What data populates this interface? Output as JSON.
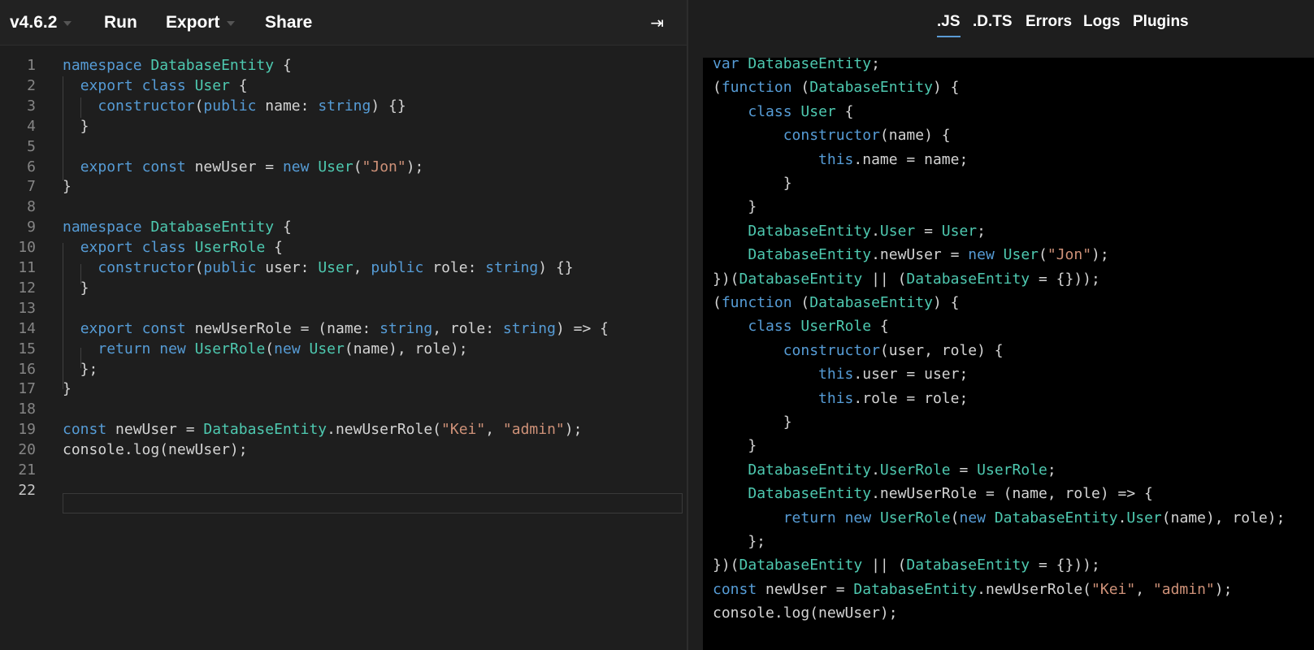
{
  "toolbar": {
    "version": "v4.6.2",
    "run": "Run",
    "export": "Export",
    "share": "Share",
    "collapse_glyph": "⇥"
  },
  "output_tabs": [
    {
      "label": ".JS",
      "active": true
    },
    {
      "label": ".D.TS",
      "active": false
    },
    {
      "label": "Errors",
      "active": false
    },
    {
      "label": "Logs",
      "active": false
    },
    {
      "label": "Plugins",
      "active": false
    }
  ],
  "colors": {
    "keyword": "#569cd6",
    "type": "#4ec9b0",
    "string": "#ce9178",
    "text": "#d4d4d4",
    "active_tab_underline": "#5b9bd5"
  },
  "editor": {
    "current_line": "22",
    "lines": [
      {
        "n": "1",
        "tokens": [
          [
            "kw",
            "namespace"
          ],
          [
            "pl",
            " "
          ],
          [
            "ty",
            "DatabaseEntity"
          ],
          [
            "pl",
            " {"
          ]
        ]
      },
      {
        "n": "2",
        "tokens": [
          [
            "pl",
            "  "
          ],
          [
            "kw",
            "export"
          ],
          [
            "pl",
            " "
          ],
          [
            "kw",
            "class"
          ],
          [
            "pl",
            " "
          ],
          [
            "ty",
            "User"
          ],
          [
            "pl",
            " {"
          ]
        ]
      },
      {
        "n": "3",
        "tokens": [
          [
            "pl",
            "    "
          ],
          [
            "kw",
            "constructor"
          ],
          [
            "pl",
            "("
          ],
          [
            "kw",
            "public"
          ],
          [
            "pl",
            " name: "
          ],
          [
            "kw",
            "string"
          ],
          [
            "pl",
            ") {}"
          ]
        ]
      },
      {
        "n": "4",
        "tokens": [
          [
            "pl",
            "  }"
          ]
        ]
      },
      {
        "n": "5",
        "tokens": []
      },
      {
        "n": "6",
        "tokens": [
          [
            "pl",
            "  "
          ],
          [
            "kw",
            "export"
          ],
          [
            "pl",
            " "
          ],
          [
            "kw",
            "const"
          ],
          [
            "pl",
            " newUser = "
          ],
          [
            "kw",
            "new"
          ],
          [
            "pl",
            " "
          ],
          [
            "ty",
            "User"
          ],
          [
            "pl",
            "("
          ],
          [
            "st",
            "\"Jon\""
          ],
          [
            "pl",
            ");"
          ]
        ]
      },
      {
        "n": "7",
        "tokens": [
          [
            "pl",
            "}"
          ]
        ]
      },
      {
        "n": "8",
        "tokens": []
      },
      {
        "n": "9",
        "tokens": [
          [
            "kw",
            "namespace"
          ],
          [
            "pl",
            " "
          ],
          [
            "ty",
            "DatabaseEntity"
          ],
          [
            "pl",
            " {"
          ]
        ]
      },
      {
        "n": "10",
        "tokens": [
          [
            "pl",
            "  "
          ],
          [
            "kw",
            "export"
          ],
          [
            "pl",
            " "
          ],
          [
            "kw",
            "class"
          ],
          [
            "pl",
            " "
          ],
          [
            "ty",
            "UserRole"
          ],
          [
            "pl",
            " {"
          ]
        ]
      },
      {
        "n": "11",
        "tokens": [
          [
            "pl",
            "    "
          ],
          [
            "kw",
            "constructor"
          ],
          [
            "pl",
            "("
          ],
          [
            "kw",
            "public"
          ],
          [
            "pl",
            " user: "
          ],
          [
            "ty",
            "User"
          ],
          [
            "pl",
            ", "
          ],
          [
            "kw",
            "public"
          ],
          [
            "pl",
            " role: "
          ],
          [
            "kw",
            "string"
          ],
          [
            "pl",
            ") {}"
          ]
        ]
      },
      {
        "n": "12",
        "tokens": [
          [
            "pl",
            "  }"
          ]
        ]
      },
      {
        "n": "13",
        "tokens": []
      },
      {
        "n": "14",
        "tokens": [
          [
            "pl",
            "  "
          ],
          [
            "kw",
            "export"
          ],
          [
            "pl",
            " "
          ],
          [
            "kw",
            "const"
          ],
          [
            "pl",
            " newUserRole = (name: "
          ],
          [
            "kw",
            "string"
          ],
          [
            "pl",
            ", role: "
          ],
          [
            "kw",
            "string"
          ],
          [
            "pl",
            ") => {"
          ]
        ]
      },
      {
        "n": "15",
        "tokens": [
          [
            "pl",
            "    "
          ],
          [
            "kw",
            "return"
          ],
          [
            "pl",
            " "
          ],
          [
            "kw",
            "new"
          ],
          [
            "pl",
            " "
          ],
          [
            "ty",
            "UserRole"
          ],
          [
            "pl",
            "("
          ],
          [
            "kw",
            "new"
          ],
          [
            "pl",
            " "
          ],
          [
            "ty",
            "User"
          ],
          [
            "pl",
            "(name), role);"
          ]
        ]
      },
      {
        "n": "16",
        "tokens": [
          [
            "pl",
            "  };"
          ]
        ]
      },
      {
        "n": "17",
        "tokens": [
          [
            "pl",
            "}"
          ]
        ]
      },
      {
        "n": "18",
        "tokens": []
      },
      {
        "n": "19",
        "tokens": [
          [
            "kw",
            "const"
          ],
          [
            "pl",
            " newUser = "
          ],
          [
            "ty",
            "DatabaseEntity"
          ],
          [
            "pl",
            ".newUserRole("
          ],
          [
            "st",
            "\"Kei\""
          ],
          [
            "pl",
            ", "
          ],
          [
            "st",
            "\"admin\""
          ],
          [
            "pl",
            ");"
          ]
        ]
      },
      {
        "n": "20",
        "tokens": [
          [
            "pl",
            "console.log(newUser);"
          ]
        ]
      },
      {
        "n": "21",
        "tokens": []
      },
      {
        "n": "22",
        "tokens": []
      }
    ]
  },
  "output": {
    "lines": [
      [
        [
          "kw",
          "var"
        ],
        [
          "pl",
          " "
        ],
        [
          "ty",
          "DatabaseEntity"
        ],
        [
          "pl",
          ";"
        ]
      ],
      [
        [
          "pl",
          "("
        ],
        [
          "kw",
          "function"
        ],
        [
          "pl",
          " ("
        ],
        [
          "ty",
          "DatabaseEntity"
        ],
        [
          "pl",
          ") {"
        ]
      ],
      [
        [
          "pl",
          "    "
        ],
        [
          "kw",
          "class"
        ],
        [
          "pl",
          " "
        ],
        [
          "ty",
          "User"
        ],
        [
          "pl",
          " {"
        ]
      ],
      [
        [
          "pl",
          "        "
        ],
        [
          "kw",
          "constructor"
        ],
        [
          "pl",
          "(name) {"
        ]
      ],
      [
        [
          "pl",
          "            "
        ],
        [
          "kw",
          "this"
        ],
        [
          "pl",
          ".name = name;"
        ]
      ],
      [
        [
          "pl",
          "        }"
        ]
      ],
      [
        [
          "pl",
          "    }"
        ]
      ],
      [
        [
          "pl",
          "    "
        ],
        [
          "ty",
          "DatabaseEntity"
        ],
        [
          "pl",
          "."
        ],
        [
          "ty",
          "User"
        ],
        [
          "pl",
          " = "
        ],
        [
          "ty",
          "User"
        ],
        [
          "pl",
          ";"
        ]
      ],
      [
        [
          "pl",
          "    "
        ],
        [
          "ty",
          "DatabaseEntity"
        ],
        [
          "pl",
          ".newUser = "
        ],
        [
          "kw",
          "new"
        ],
        [
          "pl",
          " "
        ],
        [
          "ty",
          "User"
        ],
        [
          "pl",
          "("
        ],
        [
          "st",
          "\"Jon\""
        ],
        [
          "pl",
          ");"
        ]
      ],
      [
        [
          "pl",
          "})("
        ],
        [
          "ty",
          "DatabaseEntity"
        ],
        [
          "pl",
          " || ("
        ],
        [
          "ty",
          "DatabaseEntity"
        ],
        [
          "pl",
          " = {}));"
        ]
      ],
      [
        [
          "pl",
          "("
        ],
        [
          "kw",
          "function"
        ],
        [
          "pl",
          " ("
        ],
        [
          "ty",
          "DatabaseEntity"
        ],
        [
          "pl",
          ") {"
        ]
      ],
      [
        [
          "pl",
          "    "
        ],
        [
          "kw",
          "class"
        ],
        [
          "pl",
          " "
        ],
        [
          "ty",
          "UserRole"
        ],
        [
          "pl",
          " {"
        ]
      ],
      [
        [
          "pl",
          "        "
        ],
        [
          "kw",
          "constructor"
        ],
        [
          "pl",
          "(user, role) {"
        ]
      ],
      [
        [
          "pl",
          "            "
        ],
        [
          "kw",
          "this"
        ],
        [
          "pl",
          ".user = user;"
        ]
      ],
      [
        [
          "pl",
          "            "
        ],
        [
          "kw",
          "this"
        ],
        [
          "pl",
          ".role = role;"
        ]
      ],
      [
        [
          "pl",
          "        }"
        ]
      ],
      [
        [
          "pl",
          "    }"
        ]
      ],
      [
        [
          "pl",
          "    "
        ],
        [
          "ty",
          "DatabaseEntity"
        ],
        [
          "pl",
          "."
        ],
        [
          "ty",
          "UserRole"
        ],
        [
          "pl",
          " = "
        ],
        [
          "ty",
          "UserRole"
        ],
        [
          "pl",
          ";"
        ]
      ],
      [
        [
          "pl",
          "    "
        ],
        [
          "ty",
          "DatabaseEntity"
        ],
        [
          "pl",
          ".newUserRole = (name, role) => {"
        ]
      ],
      [
        [
          "pl",
          "        "
        ],
        [
          "kw",
          "return"
        ],
        [
          "pl",
          " "
        ],
        [
          "kw",
          "new"
        ],
        [
          "pl",
          " "
        ],
        [
          "ty",
          "UserRole"
        ],
        [
          "pl",
          "("
        ],
        [
          "kw",
          "new"
        ],
        [
          "pl",
          " "
        ],
        [
          "ty",
          "DatabaseEntity"
        ],
        [
          "pl",
          "."
        ],
        [
          "ty",
          "User"
        ],
        [
          "pl",
          "(name), role);"
        ]
      ],
      [
        [
          "pl",
          "    };"
        ]
      ],
      [
        [
          "pl",
          "})("
        ],
        [
          "ty",
          "DatabaseEntity"
        ],
        [
          "pl",
          " || ("
        ],
        [
          "ty",
          "DatabaseEntity"
        ],
        [
          "pl",
          " = {}));"
        ]
      ],
      [
        [
          "kw",
          "const"
        ],
        [
          "pl",
          " newUser = "
        ],
        [
          "ty",
          "DatabaseEntity"
        ],
        [
          "pl",
          ".newUserRole("
        ],
        [
          "st",
          "\"Kei\""
        ],
        [
          "pl",
          ", "
        ],
        [
          "st",
          "\"admin\""
        ],
        [
          "pl",
          ");"
        ]
      ],
      [
        [
          "pl",
          "console.log(newUser);"
        ]
      ]
    ]
  }
}
